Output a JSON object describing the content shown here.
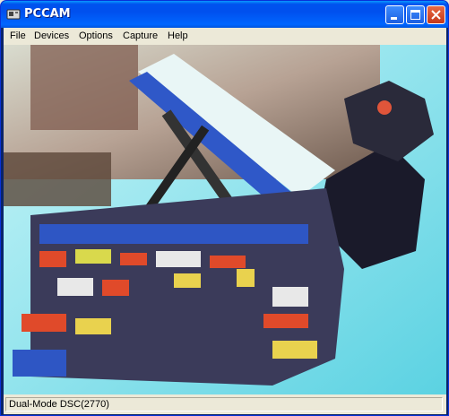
{
  "window": {
    "title": "PCCAM"
  },
  "menu": {
    "items": [
      "File",
      "Devices",
      "Options",
      "Capture",
      "Help"
    ]
  },
  "status": {
    "text": "Dual-Mode DSC(2770)"
  },
  "colors": {
    "titlebar": "#0054E3",
    "menubar": "#ECE9D8",
    "close_button": "#D9532B"
  },
  "icons": {
    "app": "webcam-icon",
    "minimize": "minimize-icon",
    "maximize": "maximize-icon",
    "close": "close-icon"
  }
}
